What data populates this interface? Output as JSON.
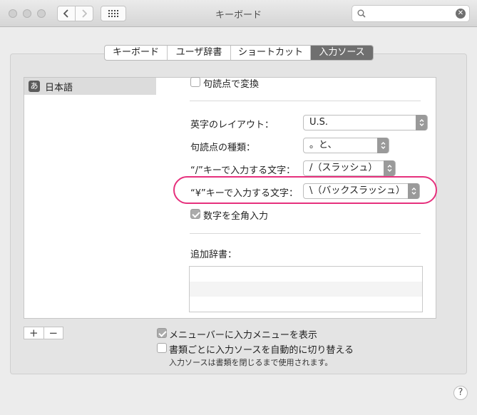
{
  "window": {
    "title": "キーボード"
  },
  "search": {
    "placeholder": "",
    "value": ""
  },
  "tabs": [
    {
      "label": "キーボード",
      "active": false
    },
    {
      "label": "ユーザ辞書",
      "active": false
    },
    {
      "label": "ショートカット",
      "active": false
    },
    {
      "label": "入力ソース",
      "active": true
    }
  ],
  "sources": [
    {
      "icon": "あ",
      "label": "日本語",
      "selected": true
    }
  ],
  "detail": {
    "convert_punct": {
      "label": "句読点で変換",
      "checked": false
    },
    "layout": {
      "label": "英字のレイアウト：",
      "value": "U.S."
    },
    "punct_type": {
      "label": "句読点の種類：",
      "value": "。と、"
    },
    "slash_key": {
      "label": "“/”キーで入力する文字：",
      "value": "/（スラッシュ）"
    },
    "yen_key": {
      "label": "“¥”キーで入力する文字：",
      "value": "\\（バックスラッシュ）"
    },
    "fullwidth_numbers": {
      "label": "数字を全角入力",
      "checked": true
    },
    "dict_label": "追加辞書："
  },
  "bottom": {
    "plus": "+",
    "minus": "−",
    "show_menu": {
      "label": "メニューバーに入力メニューを表示",
      "checked": true
    },
    "auto_switch": {
      "label": "書類ごとに入力ソースを自動的に切り替える",
      "checked": false
    },
    "note": "入力ソースは書類を閉じるまで使用されます。"
  },
  "help": "?"
}
